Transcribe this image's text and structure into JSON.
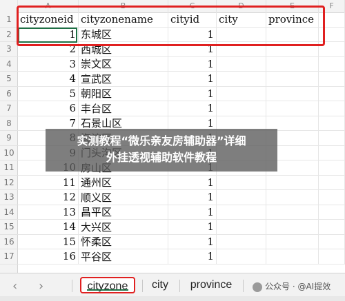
{
  "columns": [
    "A",
    "B",
    "C",
    "D",
    "E",
    "F"
  ],
  "header_row": {
    "row_num": "1",
    "cells": [
      "cityzoneid",
      "cityzonename",
      "cityid",
      "city",
      "province"
    ]
  },
  "rows": [
    {
      "row_num": "2",
      "id": "1",
      "name": "东城区",
      "cityid": "1"
    },
    {
      "row_num": "3",
      "id": "2",
      "name": "西城区",
      "cityid": "1"
    },
    {
      "row_num": "4",
      "id": "3",
      "name": "崇文区",
      "cityid": "1"
    },
    {
      "row_num": "5",
      "id": "4",
      "name": "宣武区",
      "cityid": "1"
    },
    {
      "row_num": "6",
      "id": "5",
      "name": "朝阳区",
      "cityid": "1"
    },
    {
      "row_num": "7",
      "id": "6",
      "name": "丰台区",
      "cityid": "1"
    },
    {
      "row_num": "8",
      "id": "7",
      "name": "石景山区",
      "cityid": "1"
    },
    {
      "row_num": "9",
      "id": "8",
      "name": "海淀区",
      "cityid": "1"
    },
    {
      "row_num": "10",
      "id": "9",
      "name": "门头沟区",
      "cityid": "1"
    },
    {
      "row_num": "11",
      "id": "10",
      "name": "房山区",
      "cityid": "1"
    },
    {
      "row_num": "12",
      "id": "11",
      "name": "通州区",
      "cityid": "1"
    },
    {
      "row_num": "13",
      "id": "12",
      "name": "顺义区",
      "cityid": "1"
    },
    {
      "row_num": "14",
      "id": "13",
      "name": "昌平区",
      "cityid": "1"
    },
    {
      "row_num": "15",
      "id": "14",
      "name": "大兴区",
      "cityid": "1"
    },
    {
      "row_num": "16",
      "id": "15",
      "name": "怀柔区",
      "cityid": "1"
    },
    {
      "row_num": "17",
      "id": "16",
      "name": "平谷区",
      "cityid": "1"
    }
  ],
  "banner": {
    "line1": "实测教程“微乐亲友房辅助器”详细",
    "line2": "外挂透视辅助软件教程"
  },
  "tabs": {
    "prev_icon": "chevron-left-icon",
    "next_icon": "chevron-right-icon",
    "items": [
      "cityzone",
      "city",
      "province"
    ],
    "active_index": 0
  },
  "watermark": "公众号 · @AI提效"
}
